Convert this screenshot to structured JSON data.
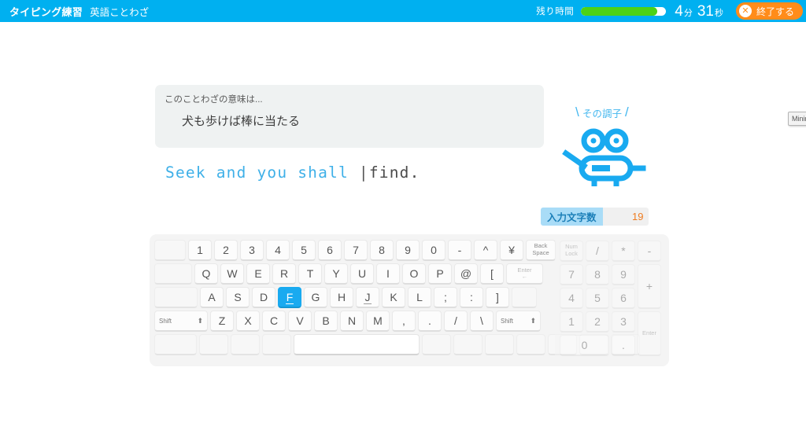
{
  "header": {
    "title": "タイピング練習",
    "subtitle": "英語ことわざ",
    "time_label": "残り時間",
    "minutes": "4",
    "minutes_unit": "分",
    "seconds": "31",
    "seconds_unit": "秒",
    "progress_percent": 90,
    "quit_icon": "✕",
    "quit_label": "終了する",
    "bg_color": "#00b0f0",
    "progress_fill_color": "#4cd217",
    "quit_color": "#ff8c1a"
  },
  "hint": {
    "label": "このことわざの意味は...",
    "text": "犬も歩けば棒に当たる"
  },
  "typing": {
    "typed": "Seek and you shall ",
    "caret": "|",
    "remaining": "find.",
    "typed_color": "#3fb0e8",
    "remaining_color": "#4a4a4a"
  },
  "mascot": {
    "cheer_text": "その調子",
    "slash_left": "\\",
    "slash_right": "/",
    "color": "#19aaf0"
  },
  "count": {
    "label": "入力文字数",
    "value": "19",
    "label_bg": "#a9dcf7",
    "value_color": "#ef7c20"
  },
  "keyboard": {
    "active_key": "F",
    "home_keys": [
      "F",
      "J"
    ],
    "rows": [
      [
        {
          "label": "",
          "w": 40,
          "type": "blank"
        },
        {
          "label": "1",
          "w": 30
        },
        {
          "label": "2",
          "w": 30
        },
        {
          "label": "3",
          "w": 30
        },
        {
          "label": "4",
          "w": 30
        },
        {
          "label": "5",
          "w": 30
        },
        {
          "label": "6",
          "w": 30
        },
        {
          "label": "7",
          "w": 30
        },
        {
          "label": "8",
          "w": 30
        },
        {
          "label": "9",
          "w": 30
        },
        {
          "label": "0",
          "w": 30
        },
        {
          "label": "-",
          "w": 30
        },
        {
          "label": "^",
          "w": 30
        },
        {
          "label": "¥",
          "w": 30
        },
        {
          "label": "Back\nSpace",
          "w": 38,
          "type": "small"
        }
      ],
      [
        {
          "label": "",
          "w": 48,
          "type": "blank"
        },
        {
          "label": "Q",
          "w": 30
        },
        {
          "label": "W",
          "w": 30
        },
        {
          "label": "E",
          "w": 30
        },
        {
          "label": "R",
          "w": 30
        },
        {
          "label": "T",
          "w": 30
        },
        {
          "label": "Y",
          "w": 30
        },
        {
          "label": "U",
          "w": 30
        },
        {
          "label": "I",
          "w": 30
        },
        {
          "label": "O",
          "w": 30
        },
        {
          "label": "P",
          "w": 30
        },
        {
          "label": "@",
          "w": 30
        },
        {
          "label": "[",
          "w": 30
        },
        {
          "label": "Enter",
          "w": 47,
          "type": "enter"
        }
      ],
      [
        {
          "label": "",
          "w": 55,
          "type": "blank"
        },
        {
          "label": "A",
          "w": 30
        },
        {
          "label": "S",
          "w": 30
        },
        {
          "label": "D",
          "w": 30
        },
        {
          "label": "F",
          "w": 30
        },
        {
          "label": "G",
          "w": 30
        },
        {
          "label": "H",
          "w": 30
        },
        {
          "label": "J",
          "w": 30
        },
        {
          "label": "K",
          "w": 30
        },
        {
          "label": "L",
          "w": 30
        },
        {
          "label": ";",
          "w": 30
        },
        {
          "label": ":",
          "w": 30
        },
        {
          "label": "]",
          "w": 30
        },
        {
          "label": "",
          "w": 32,
          "type": "blank"
        }
      ],
      [
        {
          "label": "Shift",
          "w": 68,
          "type": "shift"
        },
        {
          "label": "Z",
          "w": 30
        },
        {
          "label": "X",
          "w": 30
        },
        {
          "label": "C",
          "w": 30
        },
        {
          "label": "V",
          "w": 30
        },
        {
          "label": "B",
          "w": 30
        },
        {
          "label": "N",
          "w": 30
        },
        {
          "label": "M",
          "w": 30
        },
        {
          "label": ",",
          "w": 30
        },
        {
          "label": ".",
          "w": 30
        },
        {
          "label": "/",
          "w": 30
        },
        {
          "label": "\\",
          "w": 30
        },
        {
          "label": "Shift",
          "w": 57,
          "type": "shift"
        }
      ],
      [
        {
          "label": "",
          "w": 54,
          "type": "blank"
        },
        {
          "label": "",
          "w": 37,
          "type": "blank"
        },
        {
          "label": "",
          "w": 37,
          "type": "blank"
        },
        {
          "label": "",
          "w": 37,
          "type": "blank"
        },
        {
          "label": "",
          "w": 160,
          "type": "space"
        },
        {
          "label": "",
          "w": 37,
          "type": "blank"
        },
        {
          "label": "",
          "w": 37,
          "type": "blank"
        },
        {
          "label": "",
          "w": 37,
          "type": "blank"
        },
        {
          "label": "",
          "w": 37,
          "type": "blank"
        },
        {
          "label": "",
          "w": 37,
          "type": "blank"
        },
        {
          "label": "",
          "w": 37,
          "type": "blank"
        },
        {
          "label": "",
          "w": 37,
          "type": "blank"
        }
      ]
    ]
  },
  "numpad": {
    "rows": [
      [
        {
          "label": "Num\nLock",
          "w": 30,
          "h": 27,
          "type": "small"
        },
        {
          "label": "/",
          "w": 30,
          "h": 27
        },
        {
          "label": "*",
          "w": 30,
          "h": 27
        },
        {
          "label": "-",
          "w": 30,
          "h": 27
        }
      ],
      [
        {
          "label": "7",
          "w": 30,
          "h": 27
        },
        {
          "label": "8",
          "w": 30,
          "h": 27
        },
        {
          "label": "9",
          "w": 30,
          "h": 27
        },
        {
          "label": "+",
          "w": 30,
          "h": 57,
          "span": 2
        }
      ],
      [
        {
          "label": "4",
          "w": 30,
          "h": 27
        },
        {
          "label": "5",
          "w": 30,
          "h": 27
        },
        {
          "label": "6",
          "w": 30,
          "h": 27
        }
      ],
      [
        {
          "label": "1",
          "w": 30,
          "h": 27
        },
        {
          "label": "2",
          "w": 30,
          "h": 27
        },
        {
          "label": "3",
          "w": 30,
          "h": 27
        },
        {
          "label": "Enter",
          "w": 30,
          "h": 57,
          "span": 2,
          "type": "small"
        }
      ],
      [
        {
          "label": "0",
          "w": 63,
          "h": 27
        },
        {
          "label": ".",
          "w": 30,
          "h": 27
        }
      ]
    ]
  },
  "offscreen": {
    "mini_button_label": "Minimize"
  }
}
